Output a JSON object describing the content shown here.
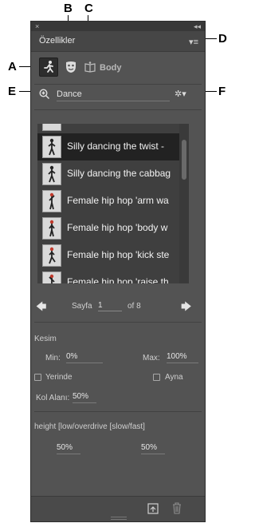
{
  "callouts": {
    "a": "A",
    "b": "B",
    "c": "C",
    "d": "D",
    "e": "E",
    "f": "F"
  },
  "window": {
    "close_glyph": "×",
    "collapse_glyph": "◂◂",
    "title": "Özellikler",
    "menu_glyph": "▾≡"
  },
  "toolbar": {
    "mode_label": "Body"
  },
  "search": {
    "value": "Dance",
    "gear_glyph": "✲▾"
  },
  "list": {
    "items": [
      {
        "label": "Silly dancing the twist - ",
        "selected": true
      },
      {
        "label": "Silly dancing the cabbag",
        "selected": false
      },
      {
        "label": "Female hip hop 'arm wa",
        "selected": false
      },
      {
        "label": "Female hip hop 'body w",
        "selected": false
      },
      {
        "label": "Female hip hop 'kick ste",
        "selected": false
      },
      {
        "label": "Female hip hop 'raise th",
        "selected": false
      }
    ]
  },
  "pager": {
    "prev_glyph": "🡄",
    "next_glyph": "🡆",
    "label": "Sayfa",
    "current": "1",
    "of_text": "of 8"
  },
  "trim": {
    "section_label": "Kesim",
    "min_label": "Min:",
    "min_value": "0%",
    "max_label": "Max:",
    "max_value": "100%",
    "in_place_label": "Yerinde",
    "mirror_label": "Ayna",
    "arm_space_label": "Kol Alanı:",
    "arm_space_value": "50%"
  },
  "height": {
    "label": "height [low/overdrive [slow/fast]",
    "left_value": "50%",
    "right_value": "50%"
  },
  "colors": {
    "panel": "#535353",
    "selected_row": "#222222",
    "accent_red": "#c0392b"
  }
}
